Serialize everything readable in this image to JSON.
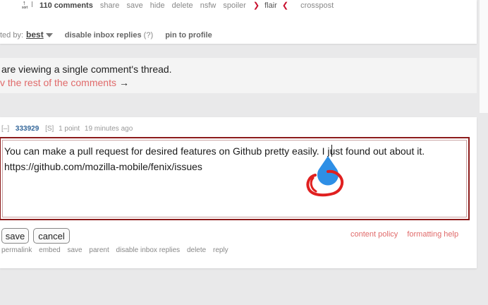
{
  "top_bar": {
    "score_symbol": "↑",
    "score_small": "sort",
    "links": [
      {
        "label": "110 comments",
        "style": "bold"
      },
      {
        "label": "share"
      },
      {
        "label": "save"
      },
      {
        "label": "hide"
      },
      {
        "label": "delete"
      },
      {
        "label": "nsfw"
      },
      {
        "label": "spoiler"
      },
      {
        "label": "flair",
        "style": "flair"
      },
      {
        "label": "crosspost"
      }
    ],
    "flair_left": "❯",
    "flair_right": "❮"
  },
  "sort_row": {
    "prefix": "ted by:",
    "value": "best",
    "disable_inbox_label": "disable inbox replies",
    "help_mark": "(?)",
    "pin_label": "pin to profile"
  },
  "notice": {
    "line1": "are viewing a single comment's thread.",
    "line2": "v the rest of the comments",
    "arrow": "→"
  },
  "comment_head": {
    "collapse": "[–]",
    "author": "333929",
    "submitter_tag": "[S]",
    "points": "1 point",
    "age": "19 minutes ago"
  },
  "editor": {
    "text": "You can make a pull request for desired features on Github pretty easily. I just found out about it. https://github.com/mozilla-mobile/fenix/issues",
    "colors": {
      "border": "#8c1b1b",
      "handle_fill": "#2e8fe6",
      "annotation": "#e02020"
    }
  },
  "actions": {
    "save": "save",
    "cancel": "cancel",
    "content_policy": "content policy",
    "formatting_help": "formatting help"
  },
  "bottom_links": [
    "permalink",
    "embed",
    "save",
    "parent",
    "disable inbox replies",
    "delete",
    "reply"
  ],
  "colors": {
    "link_accent": "#e06a6a",
    "author": "#336699",
    "background": "#e9e9ea"
  }
}
